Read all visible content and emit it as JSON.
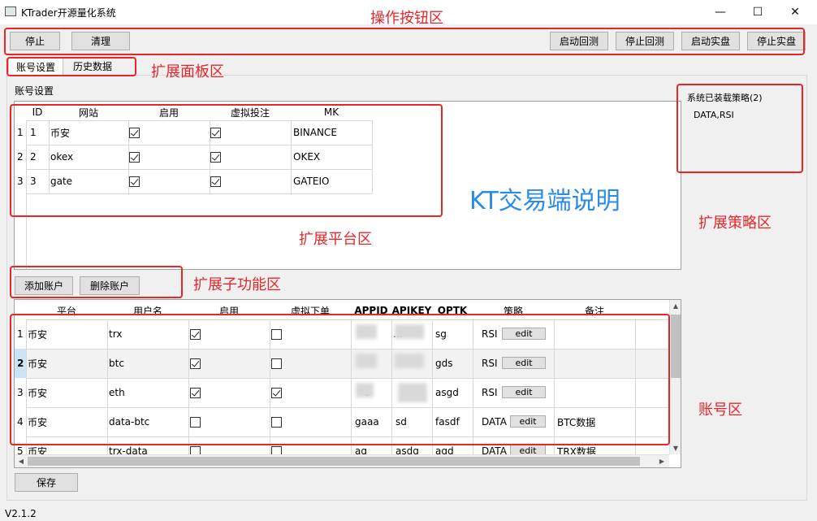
{
  "window": {
    "title": "KTrader开源量化系统",
    "controls": [
      "—",
      "☐",
      "✕"
    ]
  },
  "toolbar": {
    "stop_label": "停止",
    "clear_label": "清理",
    "start_backtest_label": "启动回测",
    "stop_backtest_label": "停止回测",
    "start_live_label": "启动实盘",
    "stop_live_label": "停止实盘"
  },
  "tabs": [
    "账号设置",
    "历史数据"
  ],
  "section_label": "账号设置",
  "platform_table": {
    "headers": [
      "ID",
      "网站",
      "启用",
      "虚拟投注",
      "MK"
    ],
    "rows": [
      {
        "num": "1",
        "id": "1",
        "site": "币安",
        "enabled": true,
        "virtual": true,
        "mk": "BINANCE"
      },
      {
        "num": "2",
        "id": "2",
        "site": "okex",
        "enabled": true,
        "virtual": true,
        "mk": "OKEX"
      },
      {
        "num": "3",
        "id": "3",
        "site": "gate",
        "enabled": true,
        "virtual": true,
        "mk": "GATEIO"
      }
    ]
  },
  "strategy_panel": {
    "title": "系统已装载策略(2)",
    "list": "DATA,RSI"
  },
  "account_buttons": {
    "add_label": "添加账户",
    "delete_label": "删除账户"
  },
  "account_table": {
    "headers": [
      "平台",
      "用户名",
      "启用",
      "虚拟下单",
      "APPID",
      "APIKEY",
      "OPTK",
      "策略",
      "备注"
    ],
    "edit_label": "edit",
    "rows": [
      {
        "num": "1",
        "platform": "币安",
        "user": "trx",
        "enabled": true,
        "virtual": false,
        "appid": "",
        "apikey": "...",
        "optk": "sg",
        "strategy": "RSI",
        "note": ""
      },
      {
        "num": "2",
        "platform": "币安",
        "user": "btc",
        "enabled": true,
        "virtual": false,
        "appid": "",
        "apikey": "",
        "optk": "gds",
        "strategy": "RSI",
        "note": ""
      },
      {
        "num": "3",
        "platform": "币安",
        "user": "eth",
        "enabled": true,
        "virtual": true,
        "appid": "d",
        "apikey": "",
        "optk": "asgd",
        "strategy": "RSI",
        "note": ""
      },
      {
        "num": "4",
        "platform": "币安",
        "user": "data-btc",
        "enabled": false,
        "virtual": false,
        "appid": "gaaa",
        "apikey": "sd",
        "optk": "fasdf",
        "strategy": "DATA",
        "note": "BTC数据"
      },
      {
        "num": "5",
        "platform": "币安",
        "user": "trx-data",
        "enabled": false,
        "virtual": false,
        "appid": "ag",
        "apikey": "asdg",
        "optk": "agd",
        "strategy": "DATA",
        "note": "TRX数据"
      }
    ]
  },
  "save_label": "保存",
  "version": "V2.1.2",
  "annotations": {
    "toolbar_area": "操作按钮区",
    "panel_area": "扩展面板区",
    "platform_area": "扩展平台区",
    "strategy_area": "扩展策略区",
    "subfunc_area": "扩展子功能区",
    "account_area": "账号区",
    "center_title": "KT交易端说明"
  },
  "colors": {
    "annotation": "#e8262a",
    "center_title": "#2b8be6"
  }
}
